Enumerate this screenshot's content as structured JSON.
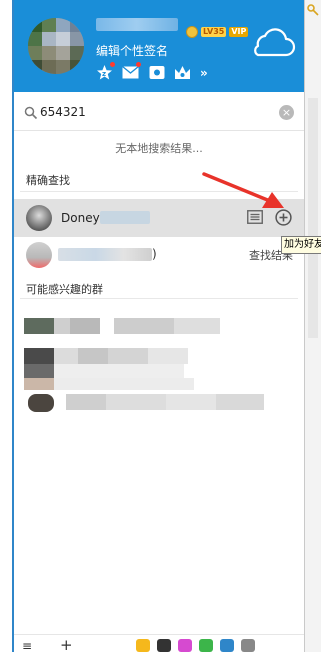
{
  "header": {
    "signature": "编辑个性签名",
    "level_badge": "LV35",
    "vip_badge": "VIP",
    "icons": [
      "qzone-star-icon",
      "mail-icon",
      "wallet-icon",
      "crown-icon"
    ],
    "more": "»"
  },
  "search": {
    "query": "654321",
    "clear": "×"
  },
  "results": {
    "no_local": "无本地搜索结果...",
    "exact_section": "精确查找",
    "user_name": "Doney",
    "second_suffix": ")",
    "find_more": "查找结果",
    "tooltip": "加为好友",
    "groups_section": "可能感兴趣的群"
  },
  "footer": {
    "menu": "≡",
    "add": "+"
  },
  "colors": {
    "header_bg": "#1a8ed8",
    "selected_row": "#e1e1e1",
    "arrow": "#e8332a"
  }
}
